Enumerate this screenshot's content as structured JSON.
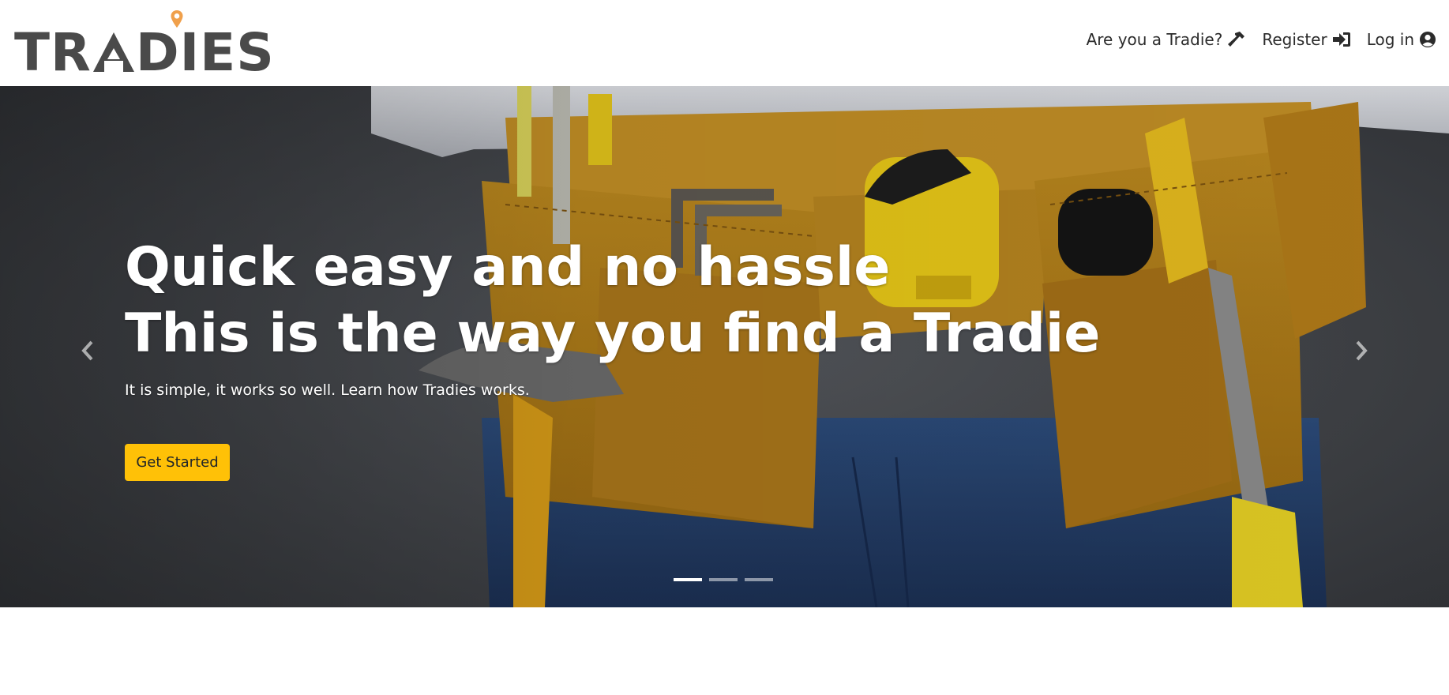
{
  "brand": {
    "name_left": "TR",
    "name_right": "DIES",
    "accent_color": "#f0a04b"
  },
  "nav": [
    {
      "label": "Are you a Tradie?",
      "icon": "hammer-icon"
    },
    {
      "label": "Register",
      "icon": "sign-in-icon"
    },
    {
      "label": "Log in",
      "icon": "user-circle-icon"
    }
  ],
  "hero": {
    "headline_line1": "Quick easy and no hassle",
    "headline_line2": "This is the way you find a Tradie",
    "subline": "It is simple, it works so well. Learn how Tradies works.",
    "cta_label": "Get Started",
    "cta_color": "#ffc107",
    "slide_count": 3,
    "active_slide": 1,
    "prev_icon": "chevron-left-icon",
    "next_icon": "chevron-right-icon"
  }
}
